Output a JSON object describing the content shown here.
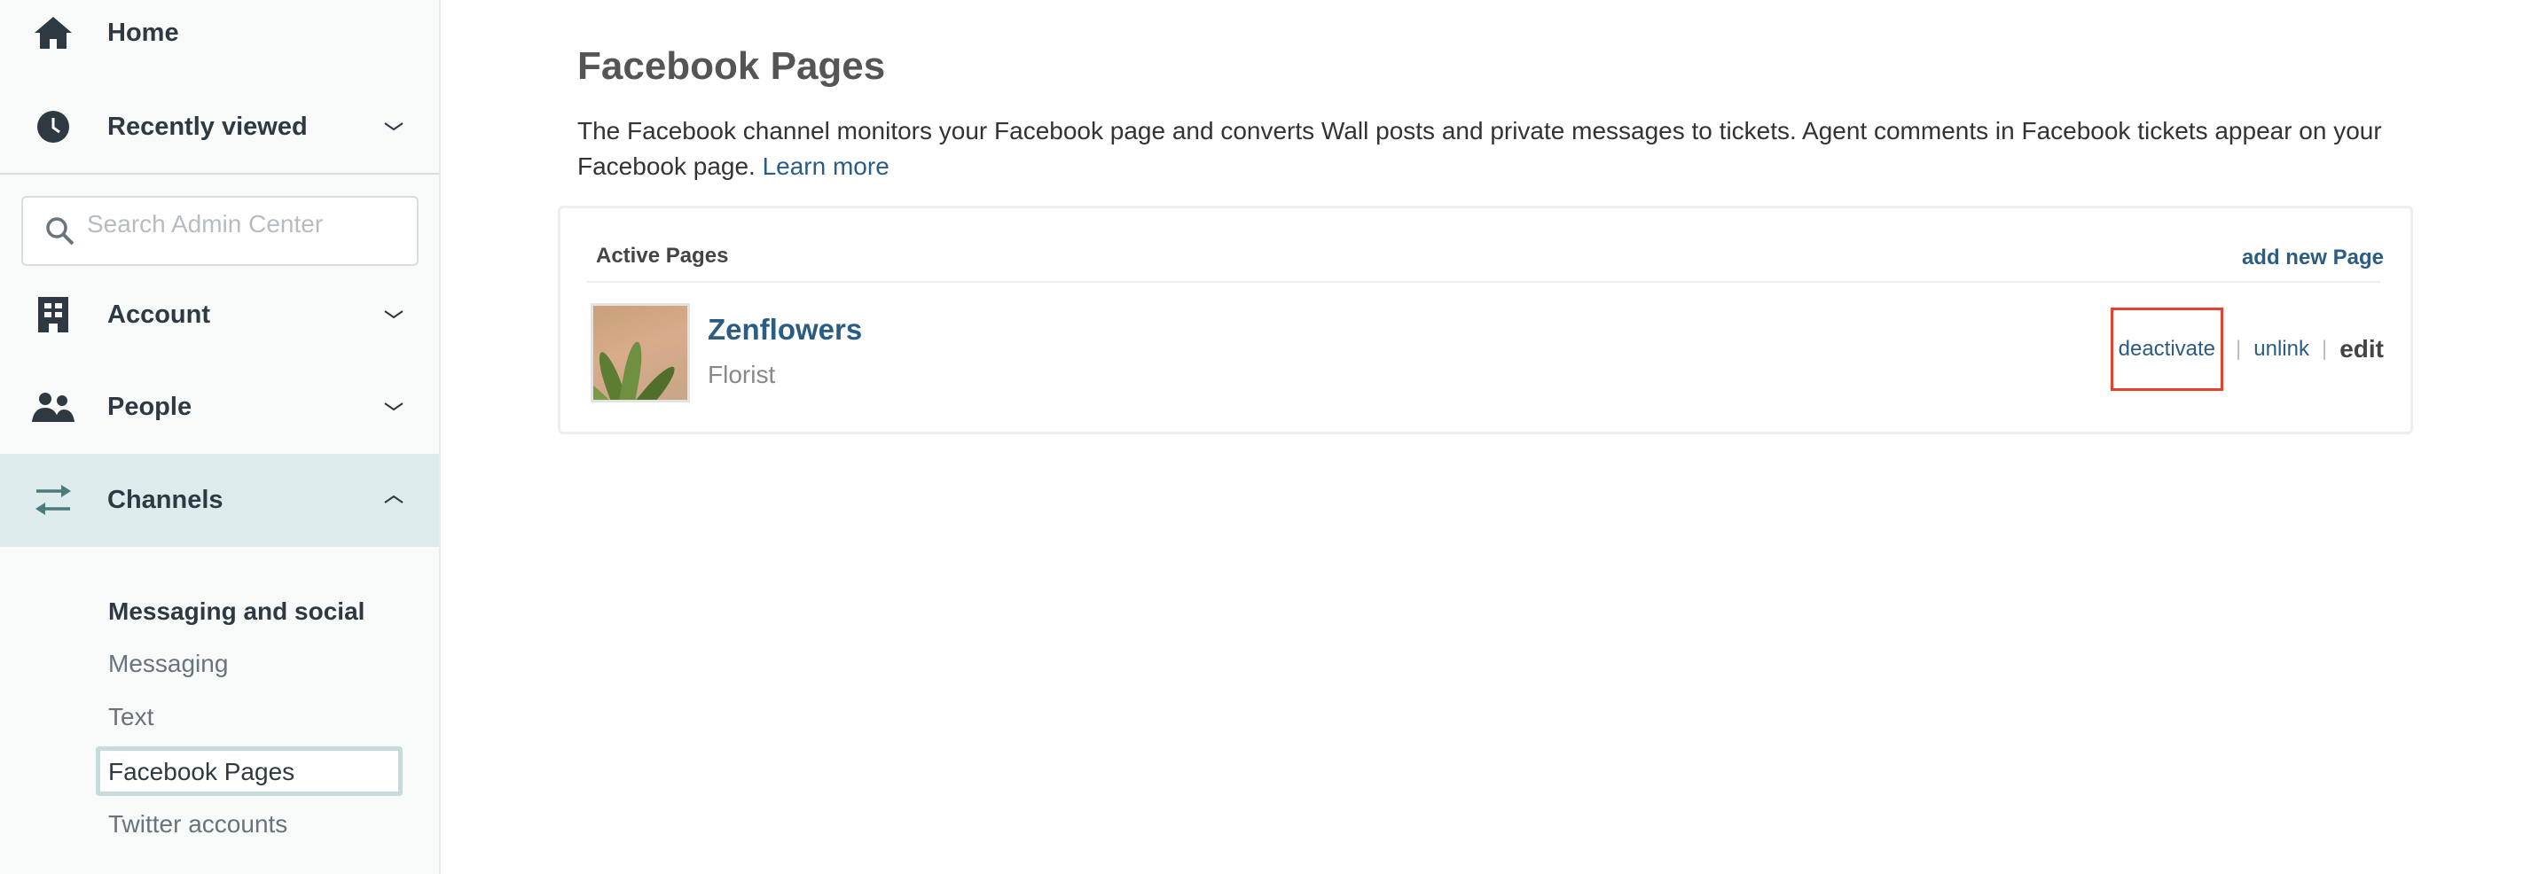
{
  "sidebar": {
    "items": [
      {
        "label": "Home",
        "icon": "home-icon"
      },
      {
        "label": "Recently viewed",
        "icon": "clock-icon"
      },
      {
        "label": "Account",
        "icon": "building-icon"
      },
      {
        "label": "People",
        "icon": "people-icon"
      },
      {
        "label": "Channels",
        "icon": "arrows-exchange-icon"
      }
    ],
    "search_placeholder": "Search Admin Center",
    "channels_sub": {
      "heading": "Messaging and social",
      "items": [
        "Messaging",
        "Text",
        "Facebook Pages",
        "Twitter accounts"
      ],
      "active": "Facebook Pages"
    }
  },
  "main": {
    "title": "Facebook Pages",
    "description": "The Facebook channel monitors your Facebook page and converts Wall posts and private messages to tickets. Agent comments in Facebook tickets appear on your Facebook page.",
    "learn_more": "Learn more",
    "card": {
      "header": "Active Pages",
      "add_new": "add new Page",
      "pages": [
        {
          "name": "Zenflowers",
          "category": "Florist",
          "actions": {
            "deactivate": "deactivate",
            "unlink": "unlink",
            "edit": "edit"
          },
          "separator": "|"
        }
      ]
    }
  },
  "colors": {
    "link": "#2a5c84",
    "highlight": "#e8402a",
    "active_band": "#deebec"
  }
}
